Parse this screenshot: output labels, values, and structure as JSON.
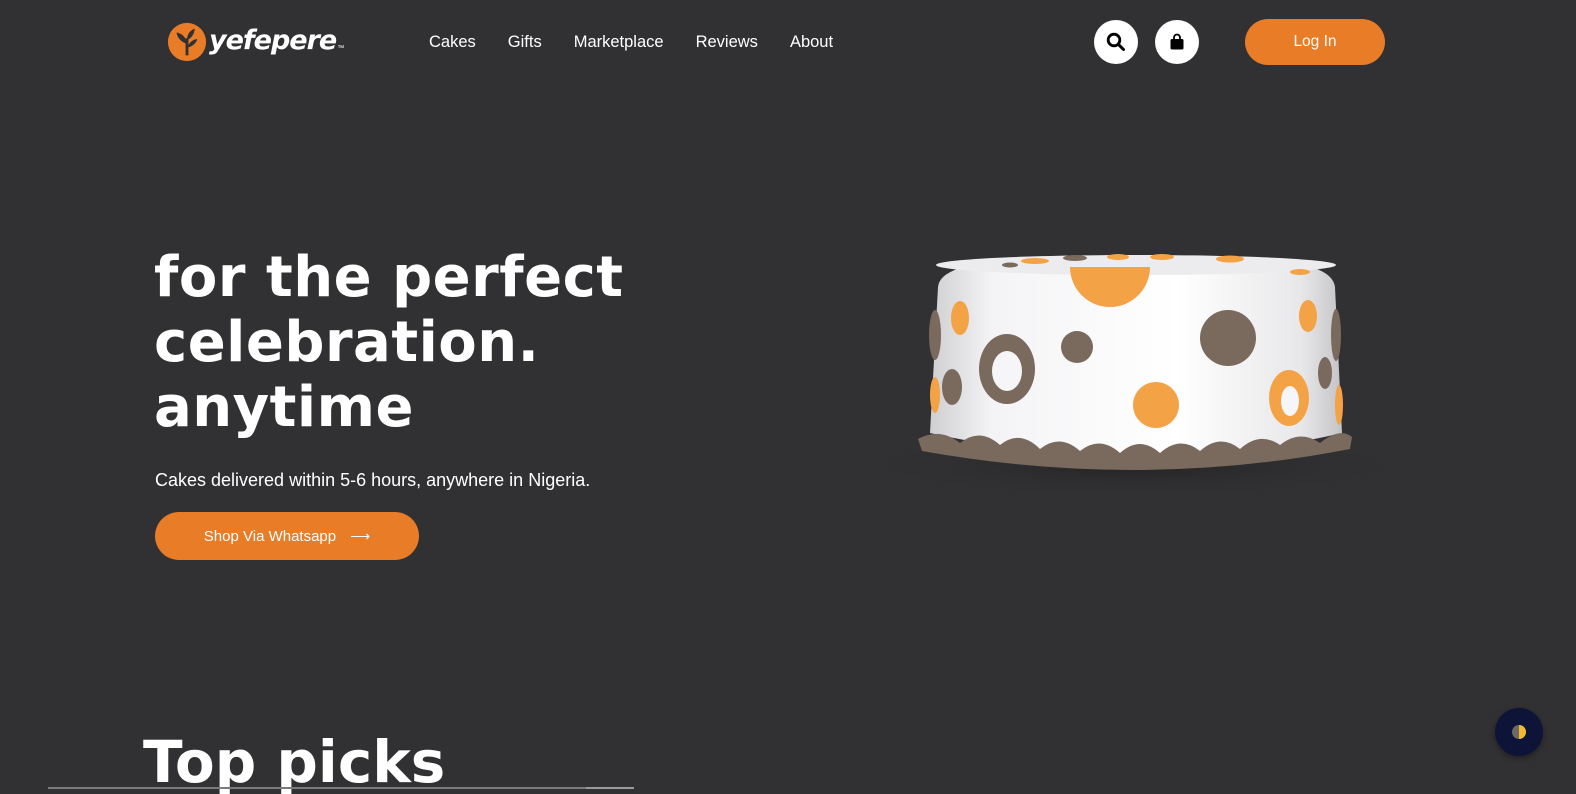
{
  "brand": {
    "name": "yefepere",
    "trademark": "™",
    "accent": "#E97C27",
    "background": "#313033"
  },
  "nav": {
    "items": [
      {
        "label": "Cakes"
      },
      {
        "label": "Gifts"
      },
      {
        "label": "Marketplace"
      },
      {
        "label": "Reviews"
      },
      {
        "label": "About"
      }
    ]
  },
  "header": {
    "search_icon": "search-icon",
    "cart_icon": "shopping-bag-icon",
    "login_label": "Log In"
  },
  "hero": {
    "title_lines": [
      "for the perfect",
      "celebration.",
      "anytime"
    ],
    "subtitle": "Cakes delivered within 5-6 hours, anywhere in Nigeria.",
    "cta_label": "Shop Via Whatsapp",
    "cta_icon": "arrow-right-icon"
  },
  "sections": {
    "top_picks_title": "Top picks"
  },
  "chat_widget": {
    "icon": "chat-widget-icon"
  }
}
